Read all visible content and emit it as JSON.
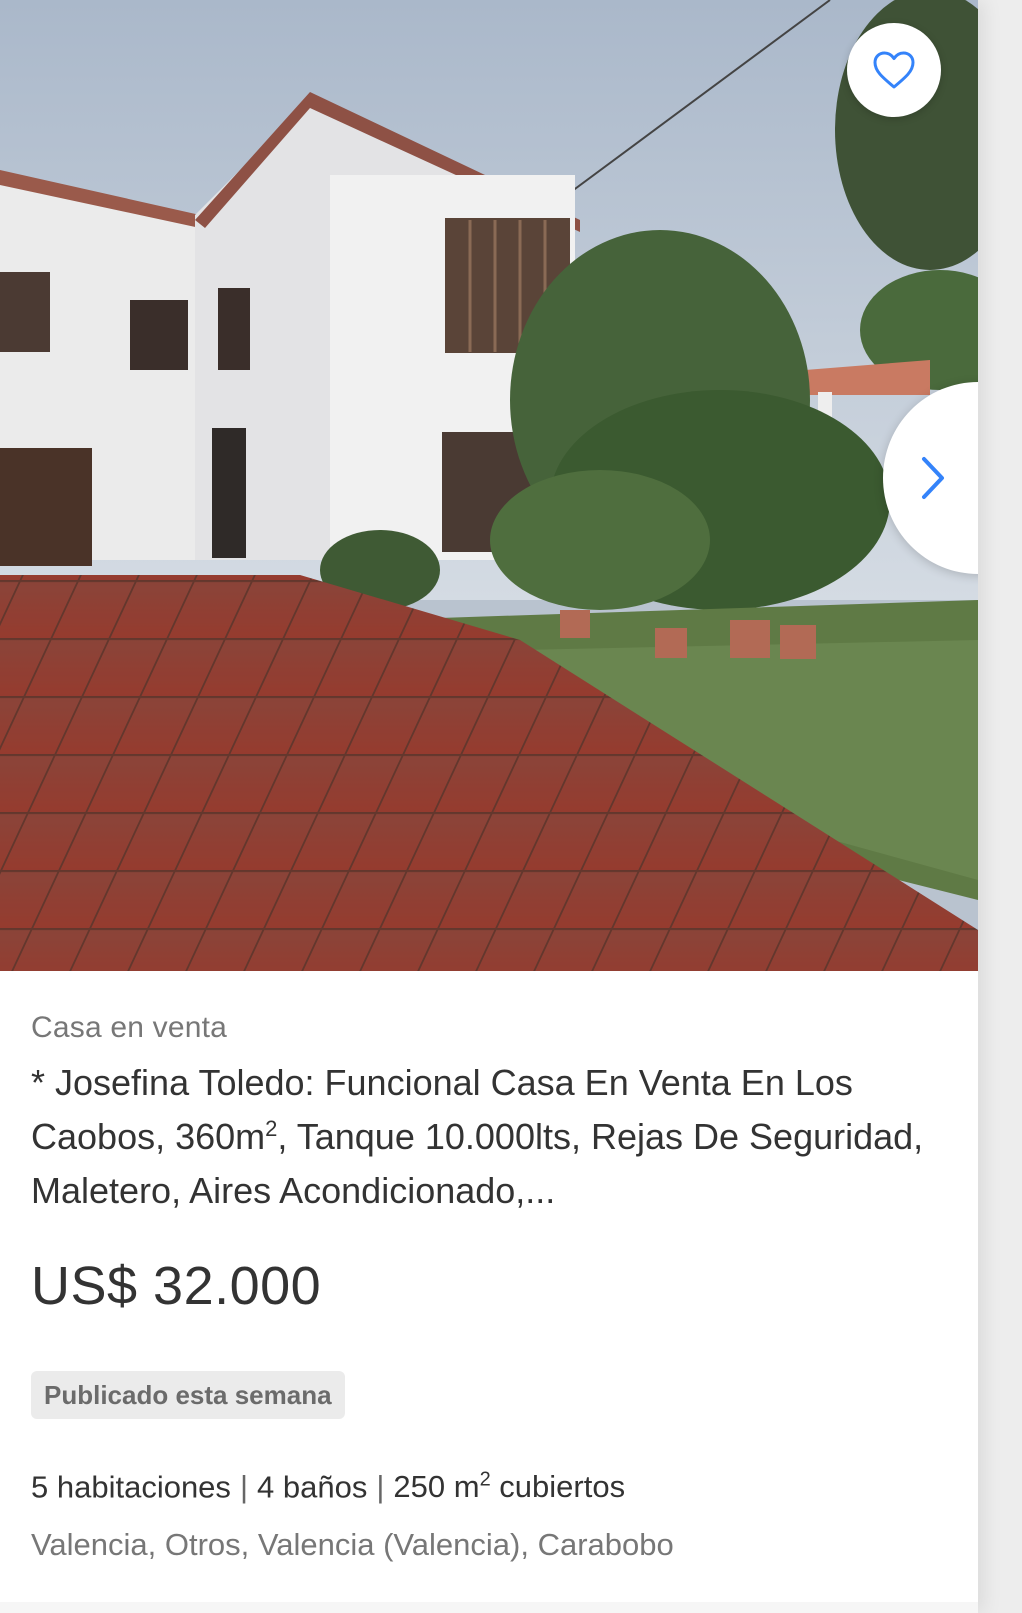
{
  "listing": {
    "favorite_icon": "heart-outline-icon",
    "next_icon": "chevron-right-icon",
    "category": "Casa en venta",
    "title_part1": "* Josefina Toledo: Funcional Casa En Venta En Los Caobos, 360m",
    "title_sup": "2",
    "title_part2": ", Tanque 10.000lts, Rejas De Seguridad, Maletero, Aires Acondicionado,...",
    "price": "US$ 32.000",
    "badge": "Publicado esta semana",
    "attributes": {
      "rooms": "5 habitaciones",
      "baths": "4 baños",
      "area_prefix": "250 m",
      "area_sup": "2",
      "area_suffix": " cubiertos"
    },
    "location": "Valencia, Otros, Valencia (Valencia), Carabobo"
  },
  "colors": {
    "accent_blue": "#3483fa",
    "text_primary": "#333333",
    "text_secondary": "#777777"
  }
}
